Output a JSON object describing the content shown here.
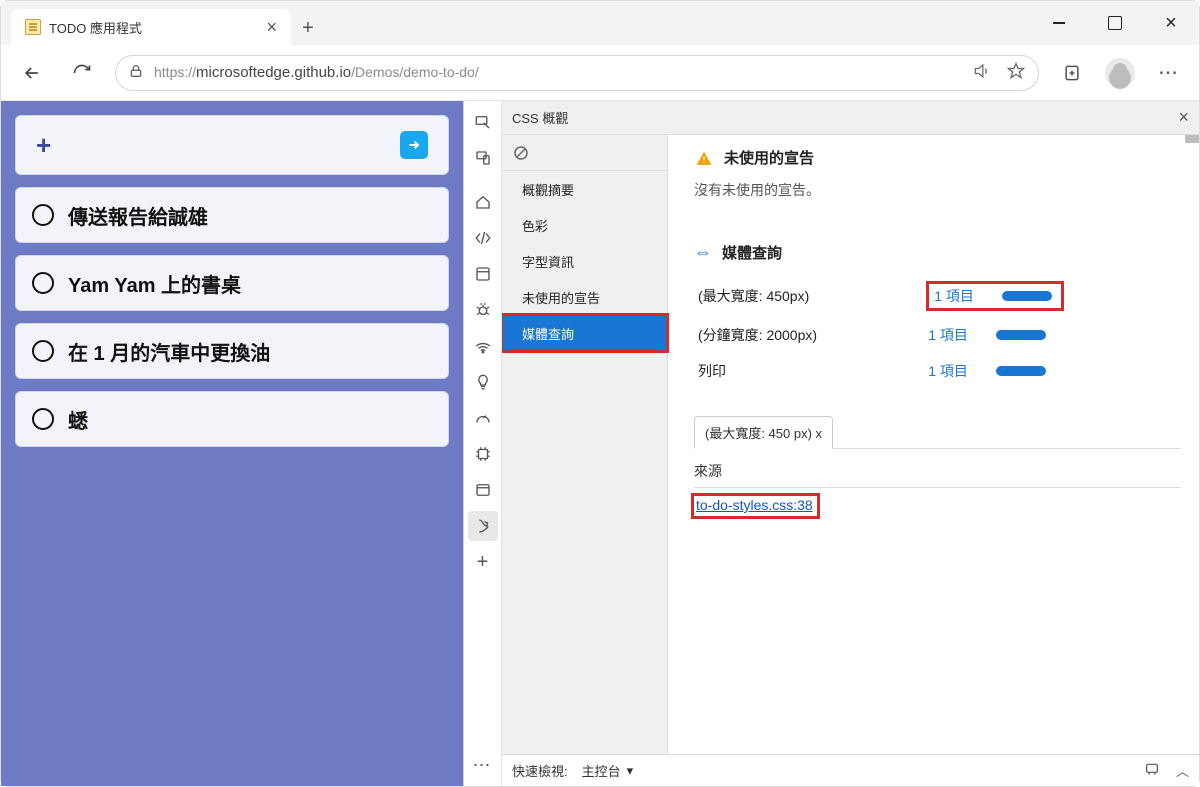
{
  "browser": {
    "tab_title": "TODO 應用程式",
    "url_prefix": "https://",
    "url_host": "microsoftedge.github.io",
    "url_path": "/Demos/demo-to-do/"
  },
  "app": {
    "todos": [
      {
        "label": "傳送報告給誠雄"
      },
      {
        "label": "Yam Yam 上的書桌"
      },
      {
        "label": "在 1 月的汽車中更換油"
      },
      {
        "label": "蟋"
      }
    ]
  },
  "devtools": {
    "panel_title": "CSS 概觀",
    "sidebar": {
      "items": [
        {
          "label": "概觀摘要"
        },
        {
          "label": "色彩"
        },
        {
          "label": "字型資訊"
        },
        {
          "label": "未使用的宣告"
        },
        {
          "label": "媒體查詢",
          "active": true
        }
      ]
    },
    "unused": {
      "heading": "未使用的宣告",
      "text": "沒有未使用的宣告。"
    },
    "media": {
      "heading": "媒體查詢",
      "rows": [
        {
          "query": "(最大寬度: 450px)",
          "count": "1 項目"
        },
        {
          "query": "(分鐘寬度: 2000px)",
          "count": "1 項目"
        },
        {
          "query": "列印",
          "count": "1 項目"
        }
      ]
    },
    "detail": {
      "breadcrumb": "(最大寬度: 450 px) x",
      "source_label": "來源",
      "source_link": "to-do-styles.css:38"
    },
    "footer": {
      "quickview": "快速檢視:",
      "console": "主控台"
    }
  }
}
